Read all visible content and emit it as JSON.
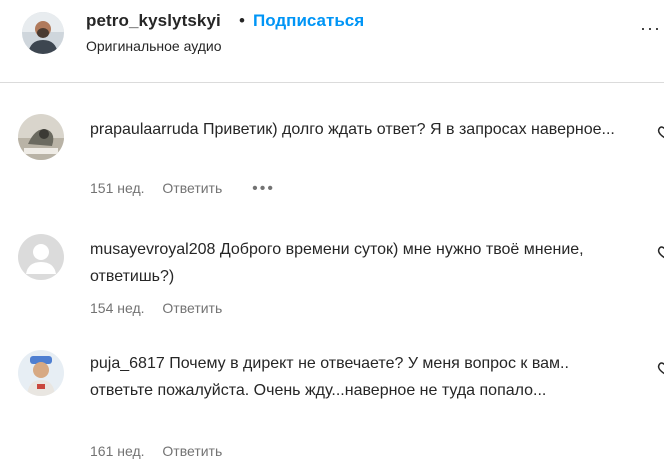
{
  "header": {
    "username": "petro_kyslytskyi",
    "separator": "•",
    "follow_label": "Подписаться",
    "subtitle": "Оригинальное аудио",
    "more_icon": "more-horizontal-icon"
  },
  "comments": [
    {
      "username": "prapaulaarruda",
      "text": "Приветик) долго ждать ответ? Я в запросах наверное...",
      "time": "151 нед.",
      "reply_label": "Ответить",
      "more": "•••",
      "avatar_icon": "user-photo-avatar"
    },
    {
      "username": "musayevroyal208",
      "text": "Доброго времени суток) мне нужно твоё мнение, ответишь?)",
      "time": "154 нед.",
      "reply_label": "Ответить",
      "avatar_icon": "default-avatar-icon"
    },
    {
      "username": "puja_6817",
      "text": "Почему в директ не отвечаете? У меня вопрос к вам.. ответьте пожалуйста. Очень жду...наверное не туда попало...",
      "time": "161 нед.",
      "reply_label": "Ответить",
      "avatar_icon": "user-photo-avatar"
    }
  ],
  "colors": {
    "accent": "#0095f6",
    "secondary_text": "#737373",
    "divider": "#dbdbdb"
  }
}
